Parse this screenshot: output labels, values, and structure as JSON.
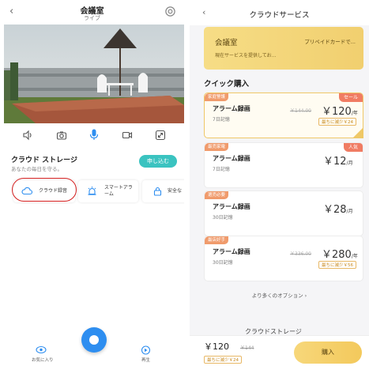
{
  "left": {
    "header": {
      "title": "会議室",
      "subtitle": "ライブ"
    },
    "controls": [
      "speaker-icon",
      "camera-icon",
      "microphone-icon",
      "video-icon",
      "fullscreen-icon"
    ],
    "cloud": {
      "title": "クラウド ストレージ",
      "subtitle": "あなたの毎日を守る。",
      "apply_label": "申し込む"
    },
    "features": [
      {
        "label": "クラウド録音",
        "icon": "cloud-icon"
      },
      {
        "label": "スマートアラーム",
        "icon": "alarm-icon"
      },
      {
        "label": "安全な",
        "icon": "lock-icon"
      }
    ],
    "bottom_nav": {
      "left_label": "お気に入り",
      "right_label": "再生"
    }
  },
  "right": {
    "header": {
      "title": "クラウドサービス"
    },
    "banner": {
      "room": "会議室",
      "prepaid": "プリペイドカードで...",
      "info": "現在サービスを提供してお..."
    },
    "quick_title": "クイック購入",
    "plans": [
      {
        "tag": "家庭警護",
        "badge": "セール",
        "name": "アラーム録画",
        "days": "7日記憶",
        "old_price": "￥144.00",
        "price": "￥120",
        "unit": "/年",
        "discount": "最ちに減少￥24",
        "selected": true
      },
      {
        "tag": "最売家電",
        "badge": "人気",
        "name": "アラーム録画",
        "days": "7日記憶",
        "old_price": "",
        "price": "￥12",
        "unit": "/月",
        "discount": "",
        "selected": false
      },
      {
        "tag": "選売必要",
        "badge": "",
        "name": "アラーム録画",
        "days": "30日記憶",
        "old_price": "",
        "price": "￥28",
        "unit": "/月",
        "discount": "",
        "selected": false
      },
      {
        "tag": "最店好手",
        "badge": "",
        "name": "アラーム録画",
        "days": "30日記憶",
        "old_price": "￥336.00",
        "price": "￥280",
        "unit": "/年",
        "discount": "最ちに減少￥56",
        "selected": false
      }
    ],
    "more_label": "より多くのオプション ›",
    "peek_label": "クラウドストレージ",
    "footer": {
      "total": "￥120",
      "old_total": "￥144",
      "discount": "最ちに減少￥24",
      "buy_label": "購入"
    }
  }
}
